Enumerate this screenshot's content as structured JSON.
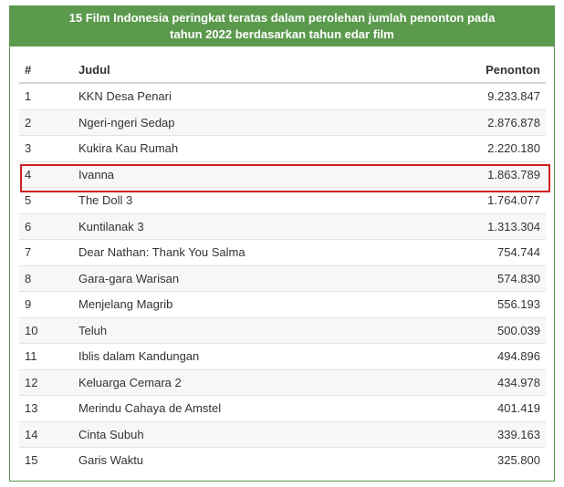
{
  "table": {
    "title_line1": "15 Film Indonesia peringkat teratas dalam perolehan jumlah penonton pada",
    "title_line2": "tahun 2022 berdasarkan tahun edar film",
    "headers": {
      "rank": "#",
      "title": "Judul",
      "viewers": "Penonton"
    },
    "rows": [
      {
        "rank": "1",
        "title": "KKN Desa Penari",
        "viewers": "9.233.847"
      },
      {
        "rank": "2",
        "title": "Ngeri-ngeri Sedap",
        "viewers": "2.876.878"
      },
      {
        "rank": "3",
        "title": "Kukira Kau Rumah",
        "viewers": "2.220.180"
      },
      {
        "rank": "4",
        "title": "Ivanna",
        "viewers": "1.863.789"
      },
      {
        "rank": "5",
        "title": "The Doll 3",
        "viewers": "1.764.077"
      },
      {
        "rank": "6",
        "title": "Kuntilanak 3",
        "viewers": "1.313.304"
      },
      {
        "rank": "7",
        "title": "Dear Nathan: Thank You Salma",
        "viewers": "754.744"
      },
      {
        "rank": "8",
        "title": "Gara-gara Warisan",
        "viewers": "574.830"
      },
      {
        "rank": "9",
        "title": "Menjelang Magrib",
        "viewers": "556.193"
      },
      {
        "rank": "10",
        "title": "Teluh",
        "viewers": "500.039"
      },
      {
        "rank": "11",
        "title": "Iblis dalam Kandungan",
        "viewers": "494.896"
      },
      {
        "rank": "12",
        "title": "Keluarga Cemara 2",
        "viewers": "434.978"
      },
      {
        "rank": "13",
        "title": "Merindu Cahaya de Amstel",
        "viewers": "401.419"
      },
      {
        "rank": "14",
        "title": "Cinta Subuh",
        "viewers": "339.163"
      },
      {
        "rank": "15",
        "title": "Garis Waktu",
        "viewers": "325.800"
      }
    ],
    "highlighted_rank": "4"
  },
  "colors": {
    "header_bg": "#5b9a4d",
    "highlight_border": "#cc2222",
    "alt_row_bg": "#f7f8f5"
  }
}
